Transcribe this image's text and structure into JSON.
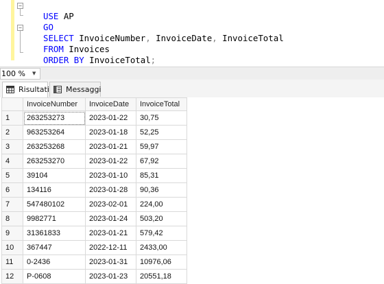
{
  "editor": {
    "lines": [
      {
        "k1": "USE",
        "t1": " AP"
      },
      {
        "k1": "GO"
      },
      {
        "k1": "SELECT",
        "t1": " InvoiceNumber",
        "p1": ",",
        "t2": " InvoiceDate",
        "p2": ",",
        "t3": " InvoiceTotal"
      },
      {
        "k1": "FROM",
        "t1": " Invoices"
      },
      {
        "k1": "ORDER BY",
        "t1": " InvoiceTotal",
        "p1": ";"
      }
    ]
  },
  "status": {
    "zoom": "100 %"
  },
  "tabs": [
    {
      "label": "Risultati",
      "icon": "grid-icon"
    },
    {
      "label": "Messaggi",
      "icon": "messages-icon"
    }
  ],
  "results": {
    "columns": [
      "InvoiceNumber",
      "InvoiceDate",
      "InvoiceTotal"
    ],
    "rows": [
      {
        "n": "1",
        "num": "263253273",
        "date": "2023-01-22",
        "total": "30,75"
      },
      {
        "n": "2",
        "num": "963253264",
        "date": "2023-01-18",
        "total": "52,25"
      },
      {
        "n": "3",
        "num": "263253268",
        "date": "2023-01-21",
        "total": "59,97"
      },
      {
        "n": "4",
        "num": "263253270",
        "date": "2023-01-22",
        "total": "67,92"
      },
      {
        "n": "5",
        "num": "39104",
        "date": "2023-01-10",
        "total": "85,31"
      },
      {
        "n": "6",
        "num": "134116",
        "date": "2023-01-28",
        "total": "90,36"
      },
      {
        "n": "7",
        "num": "547480102",
        "date": "2023-02-01",
        "total": "224,00"
      },
      {
        "n": "8",
        "num": "9982771",
        "date": "2023-01-24",
        "total": "503,20"
      },
      {
        "n": "9",
        "num": "31361833",
        "date": "2023-01-21",
        "total": "579,42"
      },
      {
        "n": "10",
        "num": "367447",
        "date": "2022-12-11",
        "total": "2433,00"
      },
      {
        "n": "11",
        "num": "0-2436",
        "date": "2023-01-31",
        "total": "10976,06"
      },
      {
        "n": "12",
        "num": "P-0608",
        "date": "2023-01-23",
        "total": "20551,18"
      }
    ]
  },
  "colors": {
    "keyword": "#0000ff",
    "identifier": "#000000",
    "punctuation": "#808080",
    "change_margin": "#fff59d"
  }
}
